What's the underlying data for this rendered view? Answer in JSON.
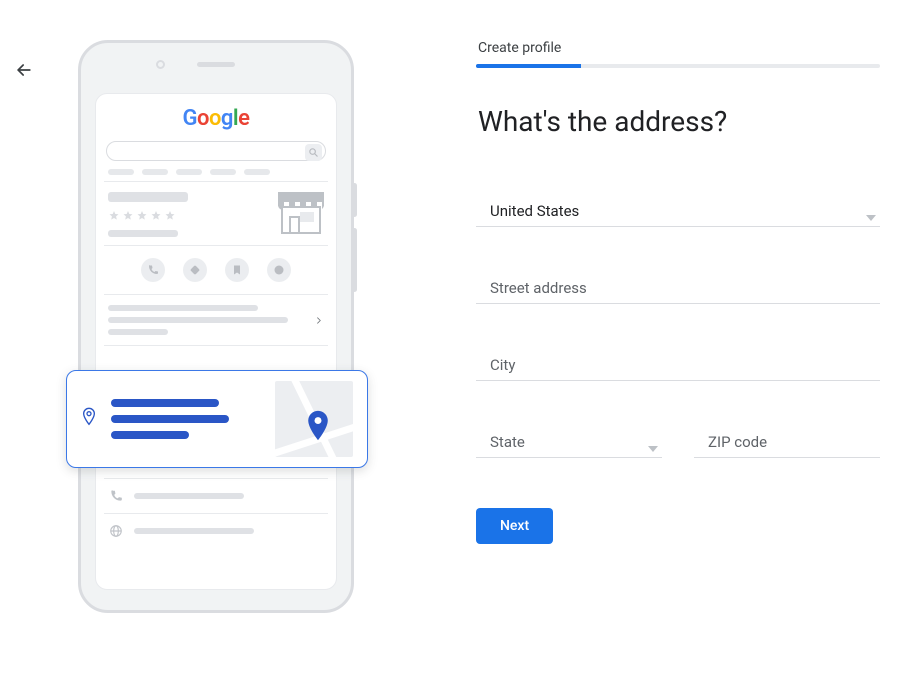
{
  "nav": {
    "back_icon": "arrow-back"
  },
  "wizard": {
    "step_label": "Create profile",
    "progress_percent": 26,
    "headline": "What's the address?"
  },
  "form": {
    "country": {
      "value": "United States"
    },
    "street": {
      "placeholder": "Street address",
      "value": ""
    },
    "city": {
      "placeholder": "City",
      "value": ""
    },
    "state": {
      "placeholder": "State",
      "value": ""
    },
    "zip": {
      "placeholder": "ZIP code",
      "value": ""
    },
    "next_label": "Next"
  },
  "illustration": {
    "logo_letters": [
      "G",
      "o",
      "o",
      "g",
      "l",
      "e"
    ]
  }
}
